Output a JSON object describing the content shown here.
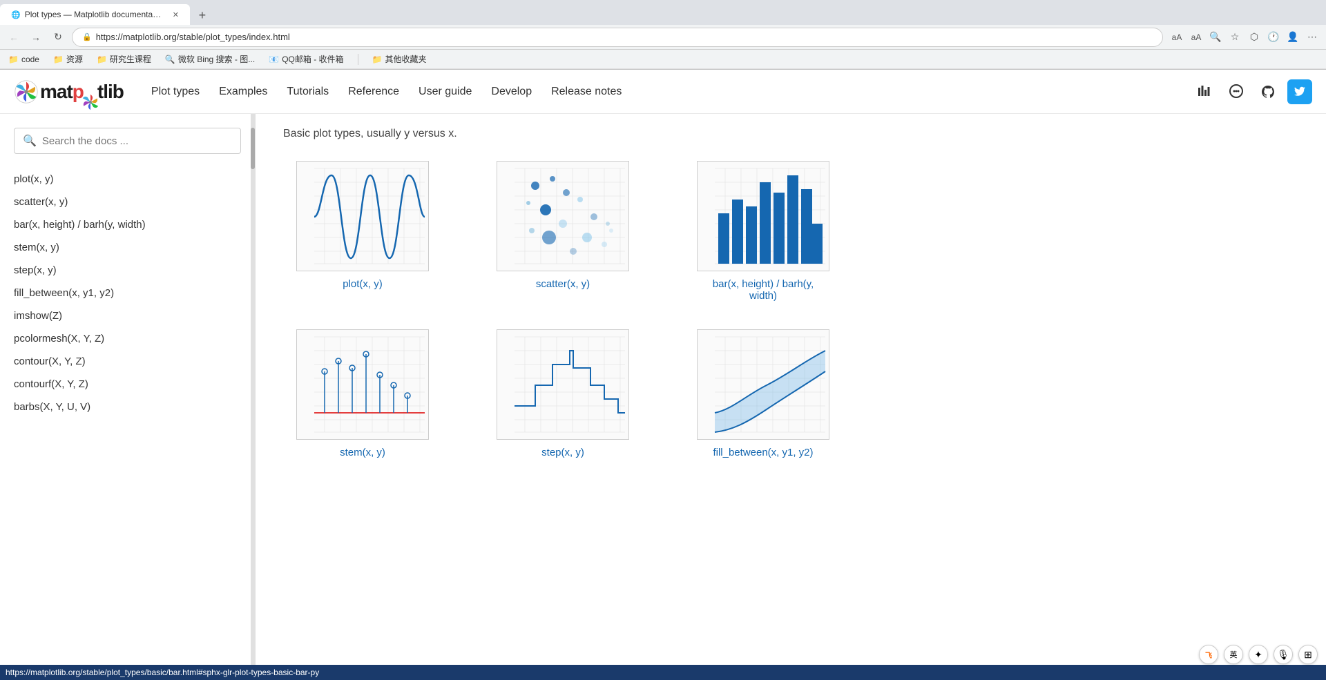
{
  "browser": {
    "tab_title": "Plot types — Matplotlib documentation",
    "url": "https://matplotlib.org/stable/plot_types/index.html",
    "back_label": "←",
    "forward_label": "→",
    "reload_label": "↻",
    "bookmarks": [
      {
        "label": "code",
        "icon": "📁"
      },
      {
        "label": "资源",
        "icon": "📁"
      },
      {
        "label": "研究生课程",
        "icon": "📁"
      },
      {
        "label": "微软 Bing 搜索 - 图...",
        "icon": "🔍"
      },
      {
        "label": "QQ邮箱 - 收件箱",
        "icon": "📧"
      },
      {
        "label": "其他收藏夹",
        "icon": "📁"
      }
    ]
  },
  "header": {
    "logo_text_before": "mat",
    "logo_text_after": "lib",
    "nav_items": [
      {
        "label": "Plot types",
        "href": "#"
      },
      {
        "label": "Examples",
        "href": "#"
      },
      {
        "label": "Tutorials",
        "href": "#"
      },
      {
        "label": "Reference",
        "href": "#"
      },
      {
        "label": "User guide",
        "href": "#"
      },
      {
        "label": "Develop",
        "href": "#"
      },
      {
        "label": "Release notes",
        "href": "#"
      }
    ]
  },
  "sidebar": {
    "search_placeholder": "Search the docs ...",
    "links": [
      {
        "label": "plot(x, y)"
      },
      {
        "label": "scatter(x, y)"
      },
      {
        "label": "bar(x, height) / barh(y, width)"
      },
      {
        "label": "stem(x, y)"
      },
      {
        "label": "step(x, y)"
      },
      {
        "label": "fill_between(x, y1, y2)"
      },
      {
        "label": "imshow(Z)"
      },
      {
        "label": "pcolormesh(X, Y, Z)"
      },
      {
        "label": "contour(X, Y, Z)"
      },
      {
        "label": "contourf(X, Y, Z)"
      },
      {
        "label": "barbs(X, Y, U, V)"
      }
    ]
  },
  "content": {
    "section_desc": "Basic plot types, usually y versus x.",
    "plots": [
      {
        "label": "plot(x, y)",
        "type": "line"
      },
      {
        "label": "scatter(x, y)",
        "type": "scatter"
      },
      {
        "label": "bar(x, height) / barh(y,\nwidth)",
        "type": "bar"
      },
      {
        "label": "stem(x, y)",
        "type": "stem"
      },
      {
        "label": "step(x, y)",
        "type": "step"
      },
      {
        "label": "fill_between(x, y1, y2)",
        "type": "fill_between"
      }
    ]
  },
  "status_bar": {
    "url": "https://matplotlib.org/stable/plot_types/basic/bar.html#sphx-glr-plot-types-basic-bar-py"
  }
}
